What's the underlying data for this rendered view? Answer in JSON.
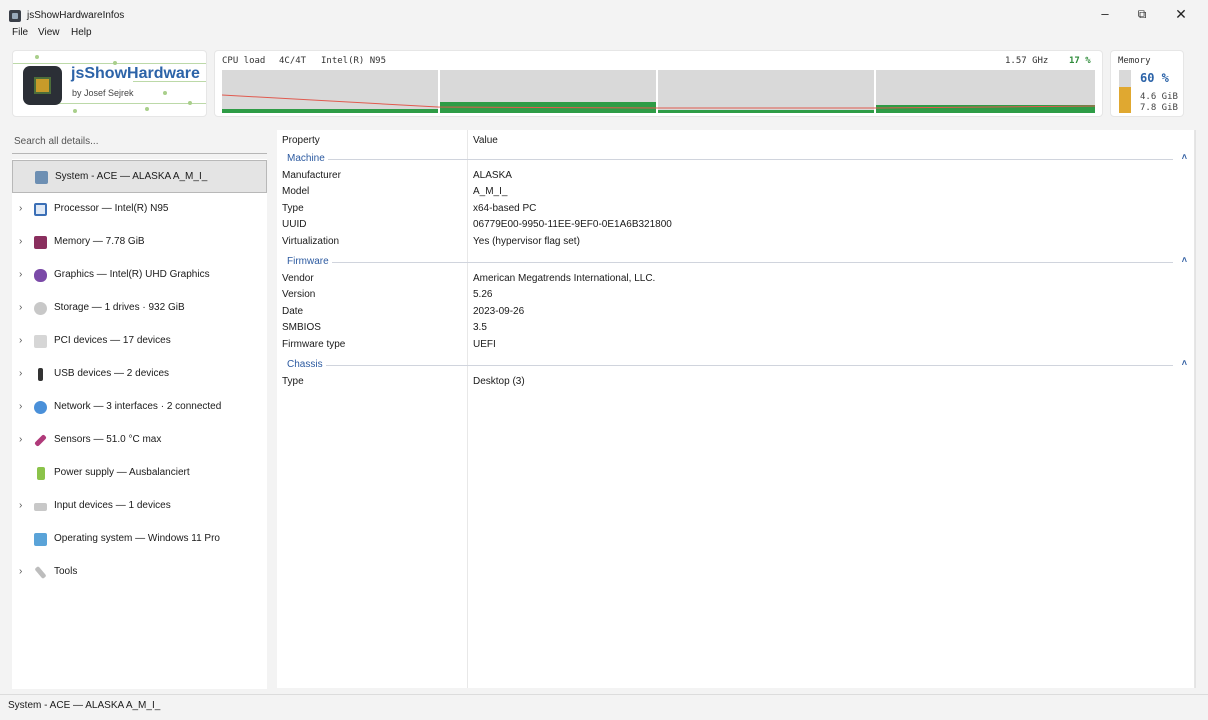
{
  "window": {
    "title": "jsShowHardwareInfos",
    "minimize": "–",
    "maximize": "⧉",
    "close": "✕"
  },
  "menu": [
    "File",
    "View",
    "Help"
  ],
  "logo": {
    "title": "jsShowHardware",
    "subtitle": "by Josef Sejrek"
  },
  "cpu": {
    "label": "CPU load",
    "cores_threads": "4C/4T",
    "model": "Intel(R) N95",
    "clock": "1.57 GHz",
    "load": "17 %",
    "core_loads": [
      0.1,
      0.25,
      0.08,
      0.18
    ],
    "accent": "#2e9c46"
  },
  "memory": {
    "title": "Memory",
    "percent": "60 %",
    "used": "4.6 GiB",
    "total": "7.8 GiB",
    "fill": 0.6,
    "accent": "#e0a830"
  },
  "search": {
    "placeholder": "Search all details..."
  },
  "tree": [
    {
      "label": "System - ACE  —  ALASKA A_M_I_",
      "icon": "system-icon",
      "chevron": "",
      "selected": true
    },
    {
      "label": "Processor  —  Intel(R) N95",
      "icon": "processor-icon",
      "chevron": "›"
    },
    {
      "label": "Memory  —  7.78 GiB",
      "icon": "memory-icon",
      "chevron": "›"
    },
    {
      "label": "Graphics  —  Intel(R) UHD Graphics",
      "icon": "graphics-icon",
      "chevron": "›"
    },
    {
      "label": "Storage  —  1 drives · 932 GiB",
      "icon": "storage-icon",
      "chevron": "›"
    },
    {
      "label": "PCI devices  —  17 devices",
      "icon": "pci-icon",
      "chevron": "›"
    },
    {
      "label": "USB devices  —  2 devices",
      "icon": "usb-icon",
      "chevron": "›"
    },
    {
      "label": "Network  —  3 interfaces · 2 connected",
      "icon": "network-icon",
      "chevron": "›"
    },
    {
      "label": "Sensors  —  51.0 °C max",
      "icon": "sensors-icon",
      "chevron": "›"
    },
    {
      "label": "Power supply  —  Ausbalanciert",
      "icon": "power-icon",
      "chevron": ""
    },
    {
      "label": "Input devices  —  1 devices",
      "icon": "keyboard-icon",
      "chevron": "›"
    },
    {
      "label": "Operating system  —  Windows 11 Pro",
      "icon": "os-icon",
      "chevron": ""
    },
    {
      "label": "Tools",
      "icon": "tools-icon",
      "chevron": "›"
    }
  ],
  "details": {
    "col_property": "Property",
    "col_value": "Value",
    "sections": [
      {
        "title": "Machine",
        "rows": [
          {
            "property": "Manufacturer",
            "value": "ALASKA"
          },
          {
            "property": "Model",
            "value": "A_M_I_"
          },
          {
            "property": "Type",
            "value": "x64-based PC"
          },
          {
            "property": "UUID",
            "value": "06779E00-9950-11EE-9EF0-0E1A6B321800"
          },
          {
            "property": "Virtualization",
            "value": "Yes (hypervisor flag set)"
          }
        ]
      },
      {
        "title": "Firmware",
        "rows": [
          {
            "property": "Vendor",
            "value": "American Megatrends International, LLC."
          },
          {
            "property": "Version",
            "value": "5.26"
          },
          {
            "property": "Date",
            "value": "2023-09-26"
          },
          {
            "property": "SMBIOS",
            "value": "3.5"
          },
          {
            "property": "Firmware type",
            "value": "UEFI"
          }
        ]
      },
      {
        "title": "Chassis",
        "rows": [
          {
            "property": "Type",
            "value": "Desktop (3)"
          }
        ]
      }
    ]
  },
  "status": {
    "text": "System - ACE — ALASKA A_M_I_"
  }
}
